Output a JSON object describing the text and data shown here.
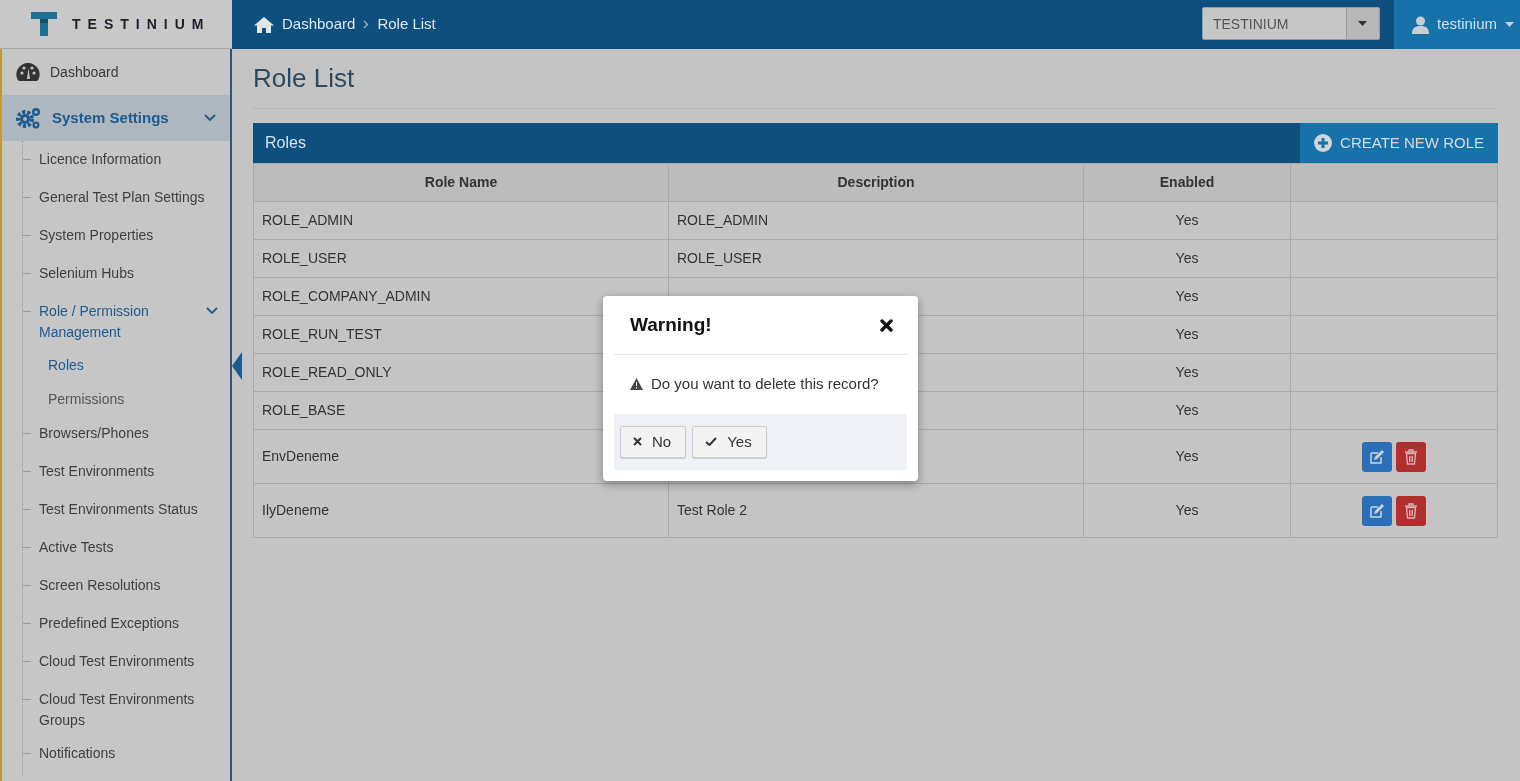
{
  "brand": {
    "name": "TESTINIUM"
  },
  "breadcrumb": [
    {
      "label": "Dashboard"
    },
    {
      "label": "Role List"
    }
  ],
  "company_select": {
    "value": "TESTINIUM"
  },
  "user_menu": {
    "label": "testinium"
  },
  "sidebar": {
    "items": [
      {
        "label": "Dashboard",
        "kind": "gauge",
        "selected": false
      },
      {
        "label": "System Settings",
        "kind": "gears",
        "selected": true,
        "expanded": true,
        "children": [
          {
            "label": "Licence Information",
            "selected": false
          },
          {
            "label": "General Test Plan Settings",
            "selected": false
          },
          {
            "label": "System Properties",
            "selected": false
          },
          {
            "label": "Selenium Hubs",
            "selected": false
          },
          {
            "label": "Role / Permission Management",
            "selected": false,
            "expanded": true,
            "children": [
              {
                "label": "Roles",
                "selected": true
              },
              {
                "label": "Permissions",
                "selected": false
              }
            ]
          },
          {
            "label": "Browsers/Phones",
            "selected": false
          },
          {
            "label": "Test Environments",
            "selected": false
          },
          {
            "label": "Test Environments Status",
            "selected": false
          },
          {
            "label": "Active Tests",
            "selected": false
          },
          {
            "label": "Screen Resolutions",
            "selected": false
          },
          {
            "label": "Predefined Exceptions",
            "selected": false
          },
          {
            "label": "Cloud Test Environments",
            "selected": false
          },
          {
            "label": "Cloud Test Environments Groups",
            "selected": false
          },
          {
            "label": "Notifications",
            "selected": false
          }
        ]
      }
    ]
  },
  "page_title": "Role List",
  "panel": {
    "title": "Roles",
    "create_button": "CREATE NEW ROLE"
  },
  "table": {
    "columns": [
      "Role Name",
      "Description",
      "Enabled"
    ],
    "rows": [
      {
        "cells": [
          "ROLE_ADMIN",
          "ROLE_ADMIN",
          "Yes"
        ],
        "editable": false
      },
      {
        "cells": [
          "ROLE_USER",
          "ROLE_USER",
          "Yes"
        ],
        "editable": false
      },
      {
        "cells": [
          "ROLE_COMPANY_ADMIN",
          "",
          "Yes"
        ],
        "editable": false
      },
      {
        "cells": [
          "ROLE_RUN_TEST",
          "",
          "Yes"
        ],
        "editable": false
      },
      {
        "cells": [
          "ROLE_READ_ONLY",
          "",
          "Yes"
        ],
        "editable": false
      },
      {
        "cells": [
          "ROLE_BASE",
          "",
          "Yes"
        ],
        "editable": false
      },
      {
        "cells": [
          "EnvDeneme",
          "",
          "Yes"
        ],
        "editable": true
      },
      {
        "cells": [
          "IlyDeneme",
          "Test Role 2",
          "Yes"
        ],
        "editable": true
      }
    ]
  },
  "modal": {
    "title": "Warning!",
    "message": "Do you want to delete this record?",
    "buttons": [
      {
        "label": "No",
        "kind": "cancel"
      },
      {
        "label": "Yes",
        "kind": "confirm"
      }
    ]
  }
}
